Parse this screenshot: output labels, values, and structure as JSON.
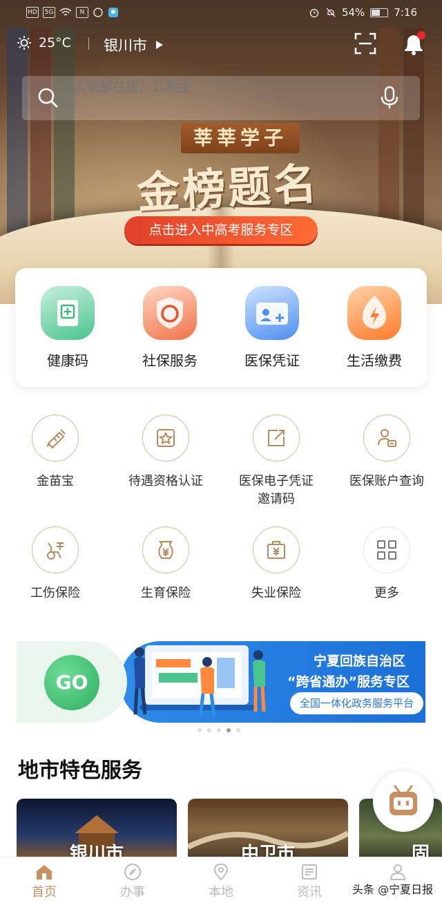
{
  "status_bar": {
    "chips": [
      "HD",
      "5G",
      "N"
    ],
    "battery": "54%",
    "time": "7:16"
  },
  "header": {
    "temperature": "25°C",
    "city": "银川市"
  },
  "search": {
    "placeholder": "大家都在搜：公积金"
  },
  "banner": {
    "subtitle": "莘莘学子",
    "title": "金榜题名",
    "cta": "点击进入中高考服务专区"
  },
  "quick_services": [
    {
      "label": "健康码",
      "icon": "health-code-icon"
    },
    {
      "label": "社保服务",
      "icon": "social-security-icon"
    },
    {
      "label": "医保凭证",
      "icon": "medical-insurance-card-icon"
    },
    {
      "label": "生活缴费",
      "icon": "utility-payment-icon"
    }
  ],
  "services": [
    {
      "label": "金苗宝",
      "icon": "vaccine-icon"
    },
    {
      "label": "待遇资格认证",
      "icon": "certification-icon"
    },
    {
      "label": "医保电子凭证邀请码",
      "icon": "invite-share-icon"
    },
    {
      "label": "医保账户查询",
      "icon": "account-query-icon"
    },
    {
      "label": "工伤保险",
      "icon": "work-injury-icon"
    },
    {
      "label": "生育保险",
      "icon": "maternity-insurance-icon"
    },
    {
      "label": "失业保险",
      "icon": "unemployment-insurance-icon"
    },
    {
      "label": "更多",
      "icon": "more-grid-icon"
    }
  ],
  "promo": {
    "go": "GO",
    "line1": "宁夏回族自治区",
    "line2": "“跨省通办”服务专区",
    "line3": "全国一体化政务服务平台"
  },
  "section": {
    "title": "地市特色服务"
  },
  "city_cards": [
    {
      "name": "银川市"
    },
    {
      "name": "中卫市"
    },
    {
      "name": "固"
    }
  ],
  "tabs": [
    {
      "label": "首页",
      "active": true
    },
    {
      "label": "办事",
      "active": false
    },
    {
      "label": "本地",
      "active": false
    },
    {
      "label": "资讯",
      "active": false
    },
    {
      "label": "我的",
      "active": false
    }
  ],
  "watermark": "头条 @宁夏日报",
  "colors": {
    "accent": "#c49064",
    "cta": "#e0412a",
    "promo_blue": "#2f8ae8",
    "go_green": "#2fae63",
    "notification_dot": "#e8262f"
  }
}
